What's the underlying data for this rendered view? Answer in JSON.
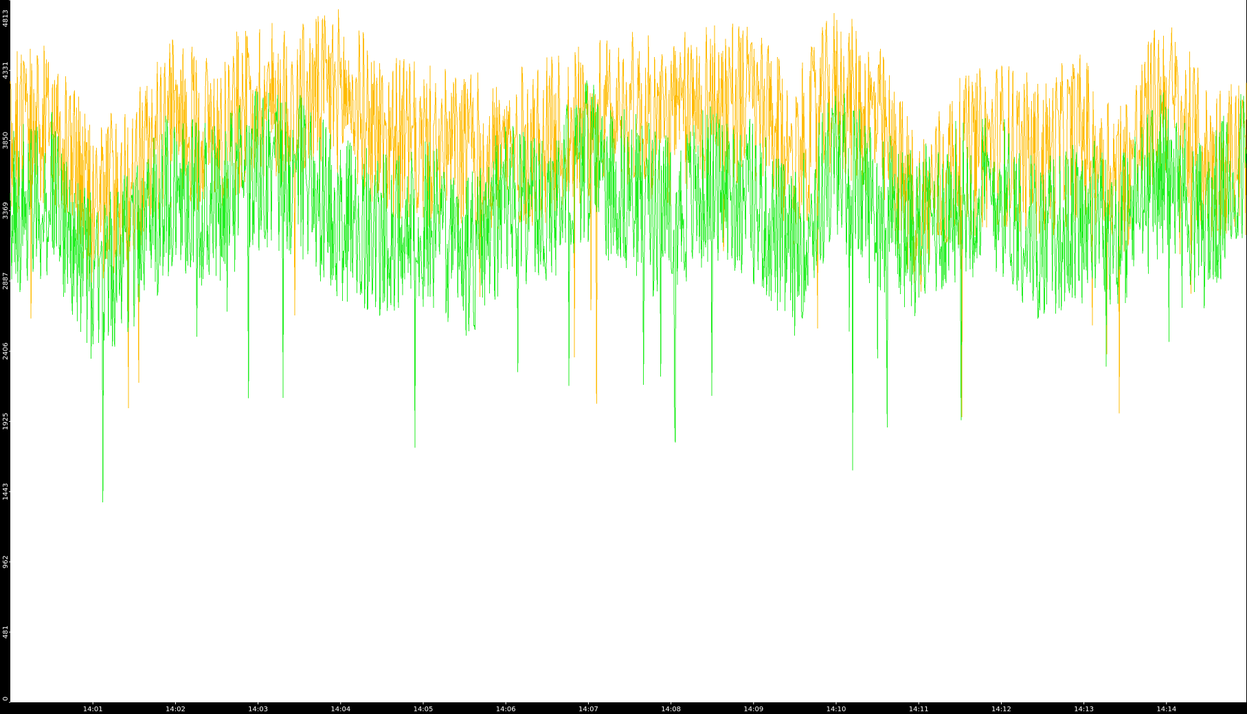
{
  "chart_data": {
    "type": "line",
    "title": "",
    "xlabel": "",
    "ylabel": "",
    "grid": false,
    "legend": "none",
    "background_color": "#ffffff",
    "frame_color": "#000000",
    "tick_label_color": "#ffffff",
    "ylim": [
      0,
      4813
    ],
    "y_ticks": [
      0,
      481,
      962,
      1443,
      1925,
      2406,
      2887,
      3369,
      3850,
      4331,
      4813
    ],
    "y_tick_labels": [
      "0",
      "481",
      "962",
      "1443",
      "1925",
      "2406",
      "2887",
      "3369",
      "3850",
      "4331",
      "4813"
    ],
    "xlim": [
      "14:00:00",
      "14:14:58"
    ],
    "x_ticks": [
      "14:01",
      "14:02",
      "14:03",
      "14:04",
      "14:05",
      "14:06",
      "14:07",
      "14:08",
      "14:09",
      "14:10",
      "14:11",
      "14:12",
      "14:13",
      "14:14"
    ],
    "x": [
      "14:00:00",
      "14:00:30",
      "14:01:00",
      "14:01:30",
      "14:02:00",
      "14:02:30",
      "14:03:00",
      "14:03:30",
      "14:04:00",
      "14:04:30",
      "14:05:00",
      "14:05:30",
      "14:06:00",
      "14:06:30",
      "14:07:00",
      "14:07:30",
      "14:08:00",
      "14:08:30",
      "14:09:00",
      "14:09:30",
      "14:10:00",
      "14:10:30",
      "14:11:00",
      "14:11:30",
      "14:12:00",
      "14:12:30",
      "14:13:00",
      "14:13:30",
      "14:14:00",
      "14:14:30",
      "14:14:58"
    ],
    "series": [
      {
        "color": "#ffbb00",
        "values": [
          3900,
          3950,
          3400,
          3600,
          4000,
          3900,
          4150,
          4100,
          4200,
          3900,
          3800,
          3750,
          3750,
          3850,
          3950,
          4050,
          3950,
          4150,
          4100,
          3700,
          4200,
          4000,
          3350,
          3700,
          3850,
          3700,
          3900,
          3600,
          4200,
          3700,
          3750
        ],
        "min": 1500,
        "max": 4813
      },
      {
        "color": "#22ee22",
        "values": [
          3350,
          3500,
          2900,
          3100,
          3550,
          3400,
          3650,
          3600,
          3300,
          3200,
          3350,
          3000,
          3400,
          3400,
          3700,
          3500,
          3300,
          3550,
          3450,
          3050,
          3700,
          3400,
          3200,
          3450,
          3500,
          3150,
          3300,
          3250,
          3650,
          3250,
          3700
        ],
        "min": 1370,
        "max": 4380
      }
    ]
  }
}
